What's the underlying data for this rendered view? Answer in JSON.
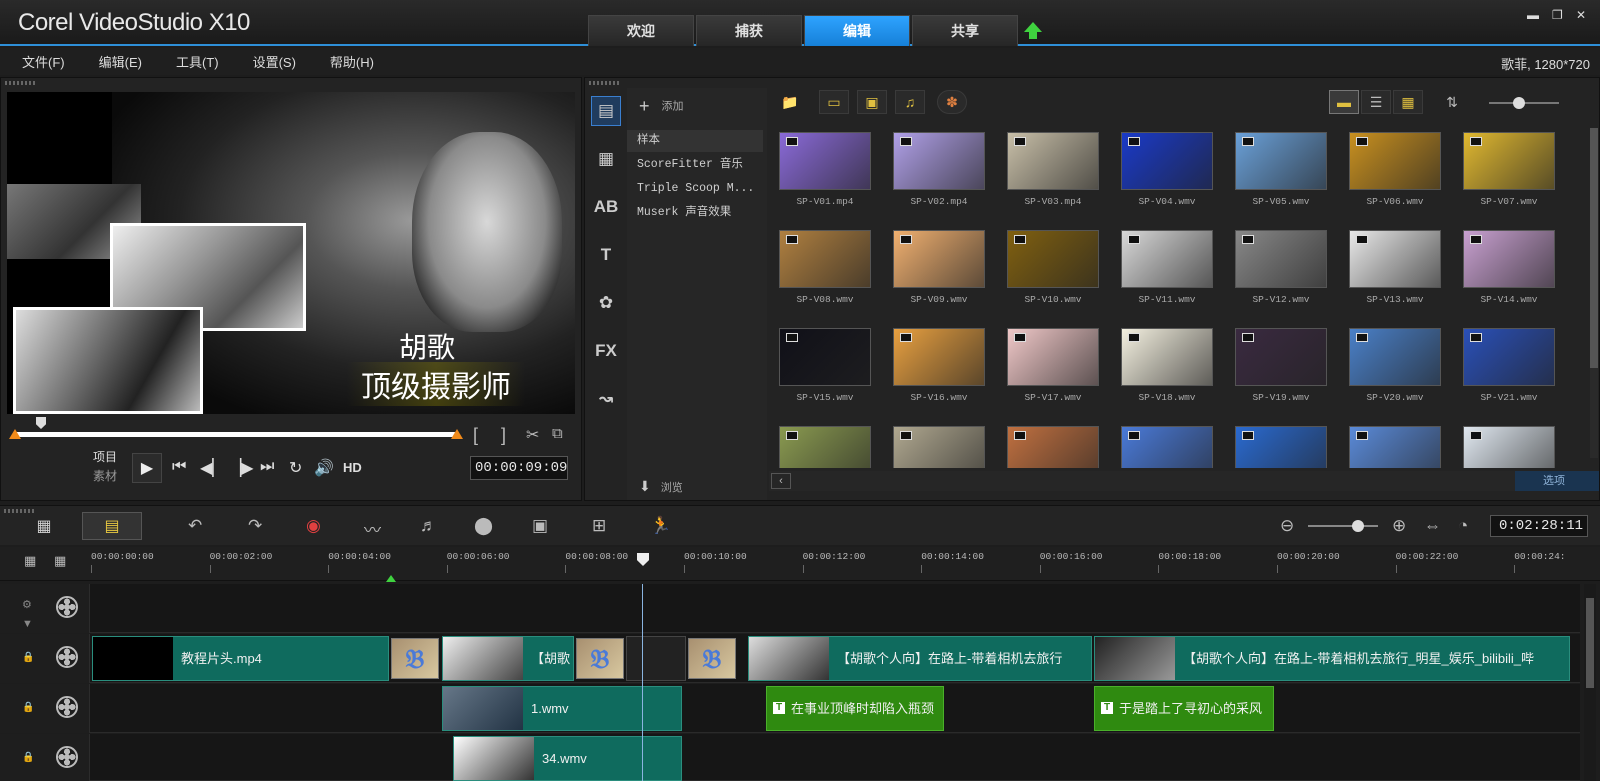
{
  "app": {
    "brand": "Corel VideoStudio X10"
  },
  "tabs": [
    {
      "label": "欢迎",
      "active": false
    },
    {
      "label": "捕获",
      "active": false
    },
    {
      "label": "编辑",
      "active": true
    },
    {
      "label": "共享",
      "active": false
    }
  ],
  "menu": [
    "文件(F)",
    "编辑(E)",
    "工具(T)",
    "设置(S)",
    "帮助(H)"
  ],
  "project_info": "歌菲, 1280*720",
  "preview": {
    "caption1": "胡歌",
    "caption2": "顶级摄影师",
    "mode_project": "项目",
    "mode_clip": "素材",
    "hd_label": "HD",
    "timecode": "00:00:09:09"
  },
  "library": {
    "add_label": "添加",
    "browse_label": "浏览",
    "options_label": "选项",
    "folders": [
      "样本",
      "ScoreFitter 音乐",
      "Triple Scoop M...",
      "Muserk 声音效果"
    ],
    "thumbs": [
      {
        "name": "SP-V01.mp4",
        "color": "#8a6ad8"
      },
      {
        "name": "SP-V02.mp4",
        "color": "#b0a0e8"
      },
      {
        "name": "SP-V03.mp4",
        "color": "#c8bfa8"
      },
      {
        "name": "SP-V04.wmv",
        "color": "#1a3ac8"
      },
      {
        "name": "SP-V05.wmv",
        "color": "#6aa0d8"
      },
      {
        "name": "SP-V06.wmv",
        "color": "#c89020"
      },
      {
        "name": "SP-V07.wmv",
        "color": "#e0b830"
      },
      {
        "name": "SP-V08.wmv",
        "color": "#b08040"
      },
      {
        "name": "SP-V09.wmv",
        "color": "#f0b070"
      },
      {
        "name": "SP-V10.wmv",
        "color": "#806010"
      },
      {
        "name": "SP-V11.wmv",
        "color": "#d8d8d8"
      },
      {
        "name": "SP-V12.wmv",
        "color": "#888"
      },
      {
        "name": "SP-V13.wmv",
        "color": "#e8e8e8"
      },
      {
        "name": "SP-V14.wmv",
        "color": "#c8a0d0"
      },
      {
        "name": "SP-V15.wmv",
        "color": "#101018"
      },
      {
        "name": "SP-V16.wmv",
        "color": "#e8a040"
      },
      {
        "name": "SP-V17.wmv",
        "color": "#f0c8c8"
      },
      {
        "name": "SP-V18.wmv",
        "color": "#f4f0e0"
      },
      {
        "name": "SP-V19.wmv",
        "color": "#3a2a40"
      },
      {
        "name": "SP-V20.wmv",
        "color": "#4a80c8"
      },
      {
        "name": "SP-V21.wmv",
        "color": "#2a50b8"
      },
      {
        "name": "",
        "color": "#8a9a50"
      },
      {
        "name": "",
        "color": "#b0a890"
      },
      {
        "name": "",
        "color": "#c07040"
      },
      {
        "name": "",
        "color": "#4a7ad8"
      },
      {
        "name": "",
        "color": "#2a6ad0"
      },
      {
        "name": "",
        "color": "#5a8ad8"
      },
      {
        "name": "",
        "color": "#e0e8f0"
      }
    ]
  },
  "timeline": {
    "total": "0:02:28:11",
    "ruler": [
      "00:00:00:00",
      "00:00:02:00",
      "00:00:04:00",
      "00:00:06:00",
      "00:00:08:00",
      "00:00:10:00",
      "00:00:12:00",
      "00:00:14:00",
      "00:00:16:00",
      "00:00:18:00",
      "00:00:20:00",
      "00:00:22:00",
      "00:00:24:"
    ],
    "video_clips": [
      {
        "label": "教程片头.mp4"
      },
      {
        "label": "【胡歌"
      },
      {
        "label": "【胡歌个人向】在路上-带着相机去旅行"
      },
      {
        "label": "【胡歌个人向】在路上-带着相机去旅行_明星_娱乐_bilibili_哔"
      }
    ],
    "overlay1": [
      {
        "label": "1.wmv"
      },
      {
        "label": "在事业顶峰时却陷入瓶颈"
      },
      {
        "label": "于是踏上了寻初心的采风"
      }
    ],
    "overlay2": [
      {
        "label": "34.wmv"
      }
    ]
  }
}
